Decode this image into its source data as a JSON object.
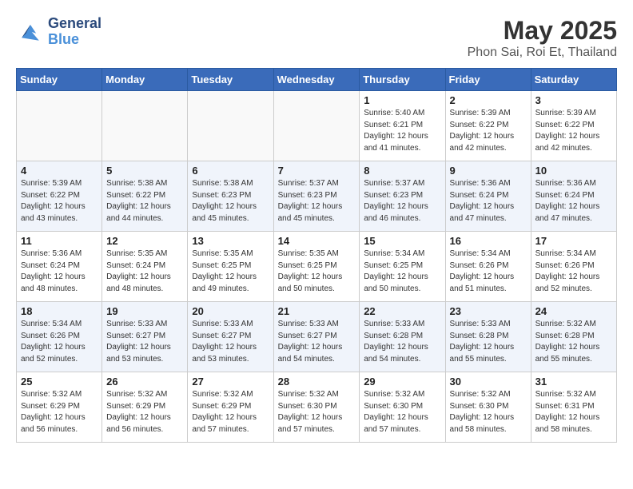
{
  "header": {
    "logo_line1": "General",
    "logo_line2": "Blue",
    "month": "May 2025",
    "location": "Phon Sai, Roi Et, Thailand"
  },
  "weekdays": [
    "Sunday",
    "Monday",
    "Tuesday",
    "Wednesday",
    "Thursday",
    "Friday",
    "Saturday"
  ],
  "weeks": [
    [
      {
        "day": "",
        "info": ""
      },
      {
        "day": "",
        "info": ""
      },
      {
        "day": "",
        "info": ""
      },
      {
        "day": "",
        "info": ""
      },
      {
        "day": "1",
        "info": "Sunrise: 5:40 AM\nSunset: 6:21 PM\nDaylight: 12 hours\nand 41 minutes."
      },
      {
        "day": "2",
        "info": "Sunrise: 5:39 AM\nSunset: 6:22 PM\nDaylight: 12 hours\nand 42 minutes."
      },
      {
        "day": "3",
        "info": "Sunrise: 5:39 AM\nSunset: 6:22 PM\nDaylight: 12 hours\nand 42 minutes."
      }
    ],
    [
      {
        "day": "4",
        "info": "Sunrise: 5:39 AM\nSunset: 6:22 PM\nDaylight: 12 hours\nand 43 minutes."
      },
      {
        "day": "5",
        "info": "Sunrise: 5:38 AM\nSunset: 6:22 PM\nDaylight: 12 hours\nand 44 minutes."
      },
      {
        "day": "6",
        "info": "Sunrise: 5:38 AM\nSunset: 6:23 PM\nDaylight: 12 hours\nand 45 minutes."
      },
      {
        "day": "7",
        "info": "Sunrise: 5:37 AM\nSunset: 6:23 PM\nDaylight: 12 hours\nand 45 minutes."
      },
      {
        "day": "8",
        "info": "Sunrise: 5:37 AM\nSunset: 6:23 PM\nDaylight: 12 hours\nand 46 minutes."
      },
      {
        "day": "9",
        "info": "Sunrise: 5:36 AM\nSunset: 6:24 PM\nDaylight: 12 hours\nand 47 minutes."
      },
      {
        "day": "10",
        "info": "Sunrise: 5:36 AM\nSunset: 6:24 PM\nDaylight: 12 hours\nand 47 minutes."
      }
    ],
    [
      {
        "day": "11",
        "info": "Sunrise: 5:36 AM\nSunset: 6:24 PM\nDaylight: 12 hours\nand 48 minutes."
      },
      {
        "day": "12",
        "info": "Sunrise: 5:35 AM\nSunset: 6:24 PM\nDaylight: 12 hours\nand 48 minutes."
      },
      {
        "day": "13",
        "info": "Sunrise: 5:35 AM\nSunset: 6:25 PM\nDaylight: 12 hours\nand 49 minutes."
      },
      {
        "day": "14",
        "info": "Sunrise: 5:35 AM\nSunset: 6:25 PM\nDaylight: 12 hours\nand 50 minutes."
      },
      {
        "day": "15",
        "info": "Sunrise: 5:34 AM\nSunset: 6:25 PM\nDaylight: 12 hours\nand 50 minutes."
      },
      {
        "day": "16",
        "info": "Sunrise: 5:34 AM\nSunset: 6:26 PM\nDaylight: 12 hours\nand 51 minutes."
      },
      {
        "day": "17",
        "info": "Sunrise: 5:34 AM\nSunset: 6:26 PM\nDaylight: 12 hours\nand 52 minutes."
      }
    ],
    [
      {
        "day": "18",
        "info": "Sunrise: 5:34 AM\nSunset: 6:26 PM\nDaylight: 12 hours\nand 52 minutes."
      },
      {
        "day": "19",
        "info": "Sunrise: 5:33 AM\nSunset: 6:27 PM\nDaylight: 12 hours\nand 53 minutes."
      },
      {
        "day": "20",
        "info": "Sunrise: 5:33 AM\nSunset: 6:27 PM\nDaylight: 12 hours\nand 53 minutes."
      },
      {
        "day": "21",
        "info": "Sunrise: 5:33 AM\nSunset: 6:27 PM\nDaylight: 12 hours\nand 54 minutes."
      },
      {
        "day": "22",
        "info": "Sunrise: 5:33 AM\nSunset: 6:28 PM\nDaylight: 12 hours\nand 54 minutes."
      },
      {
        "day": "23",
        "info": "Sunrise: 5:33 AM\nSunset: 6:28 PM\nDaylight: 12 hours\nand 55 minutes."
      },
      {
        "day": "24",
        "info": "Sunrise: 5:32 AM\nSunset: 6:28 PM\nDaylight: 12 hours\nand 55 minutes."
      }
    ],
    [
      {
        "day": "25",
        "info": "Sunrise: 5:32 AM\nSunset: 6:29 PM\nDaylight: 12 hours\nand 56 minutes."
      },
      {
        "day": "26",
        "info": "Sunrise: 5:32 AM\nSunset: 6:29 PM\nDaylight: 12 hours\nand 56 minutes."
      },
      {
        "day": "27",
        "info": "Sunrise: 5:32 AM\nSunset: 6:29 PM\nDaylight: 12 hours\nand 57 minutes."
      },
      {
        "day": "28",
        "info": "Sunrise: 5:32 AM\nSunset: 6:30 PM\nDaylight: 12 hours\nand 57 minutes."
      },
      {
        "day": "29",
        "info": "Sunrise: 5:32 AM\nSunset: 6:30 PM\nDaylight: 12 hours\nand 57 minutes."
      },
      {
        "day": "30",
        "info": "Sunrise: 5:32 AM\nSunset: 6:30 PM\nDaylight: 12 hours\nand 58 minutes."
      },
      {
        "day": "31",
        "info": "Sunrise: 5:32 AM\nSunset: 6:31 PM\nDaylight: 12 hours\nand 58 minutes."
      }
    ]
  ]
}
